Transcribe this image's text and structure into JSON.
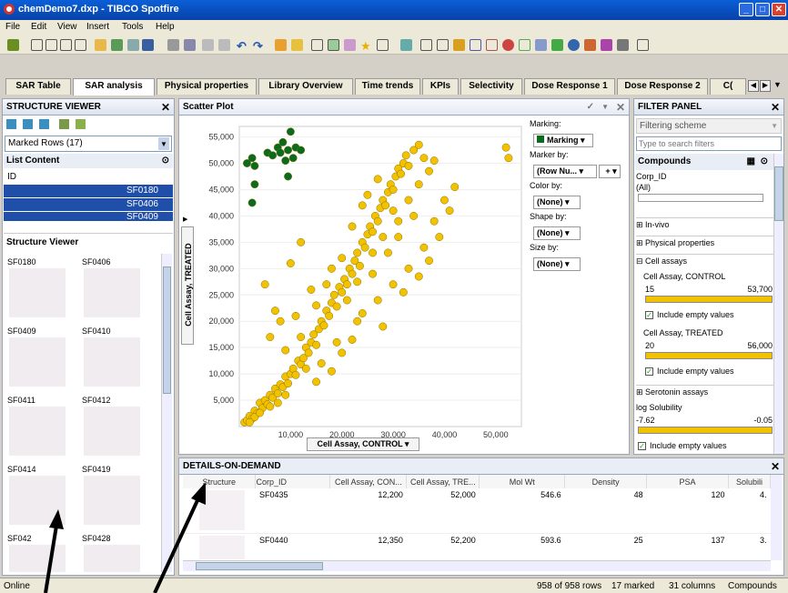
{
  "window": {
    "title": "chemDemo7.dxp - TIBCO Spotfire"
  },
  "menu": [
    "File",
    "Edit",
    "View",
    "Insert",
    "Tools",
    "Help"
  ],
  "tabs": [
    "SAR Table",
    "SAR analysis",
    "Physical properties",
    "Library Overview",
    "Time trends",
    "KPIs",
    "Selectivity",
    "Dose Response 1",
    "Dose Response 2",
    "C("
  ],
  "structure_viewer": {
    "title": "STRUCTURE VIEWER",
    "marking_select": "Marked Rows (17)",
    "list_content_label": "List Content",
    "list_header": "ID",
    "list_items": [
      "SF0180",
      "SF0406",
      "SF0409"
    ],
    "viewer_label": "Structure Viewer",
    "thumbs": [
      "SF0180",
      "SF0406",
      "SF0409",
      "SF0410",
      "SF0411",
      "SF0412",
      "SF0414",
      "SF0419",
      "SF042",
      "SF0428"
    ]
  },
  "scatter": {
    "title": "Scatter Plot",
    "marking_label": "Marking:",
    "marking_value": "Marking",
    "marker_by_label": "Marker by:",
    "marker_by_value": "(Row Nu...",
    "color_by_label": "Color by:",
    "color_by_value": "(None)",
    "shape_by_label": "Shape by:",
    "shape_by_value": "(None)",
    "size_by_label": "Size by:",
    "size_by_value": "(None)",
    "x_axis_selector": "Cell Assay, CONTROL",
    "y_axis_selector": "Cell Assay, TREATED"
  },
  "chart_data": {
    "type": "scatter",
    "xlabel": "Cell Assay, CONTROL",
    "ylabel": "Cell Assay, TREATED",
    "xlim": [
      0,
      55000
    ],
    "ylim": [
      0,
      57000
    ],
    "xticks": [
      "10,000",
      "20,000",
      "30,000",
      "40,000",
      "50,000"
    ],
    "yticks": [
      "5,000",
      "10,000",
      "15,000",
      "20,000",
      "25,000",
      "30,000",
      "35,000",
      "40,000",
      "45,000",
      "50,000",
      "55,000"
    ],
    "series": [
      {
        "color": "#f2c200",
        "points": [
          [
            1000,
            800
          ],
          [
            1500,
            1200
          ],
          [
            2000,
            2000
          ],
          [
            2500,
            1500
          ],
          [
            3000,
            3000
          ],
          [
            3500,
            2500
          ],
          [
            4000,
            4500
          ],
          [
            4500,
            3500
          ],
          [
            5000,
            5000
          ],
          [
            5500,
            4200
          ],
          [
            6000,
            6000
          ],
          [
            6500,
            5500
          ],
          [
            7000,
            7200
          ],
          [
            7500,
            6300
          ],
          [
            8000,
            8000
          ],
          [
            8500,
            7500
          ],
          [
            9000,
            9500
          ],
          [
            9500,
            8200
          ],
          [
            10000,
            10000
          ],
          [
            10500,
            11000
          ],
          [
            11000,
            9800
          ],
          [
            11500,
            12500
          ],
          [
            12000,
            11800
          ],
          [
            12500,
            13000
          ],
          [
            13000,
            15000
          ],
          [
            13500,
            14000
          ],
          [
            14000,
            16000
          ],
          [
            14500,
            17500
          ],
          [
            15000,
            15500
          ],
          [
            15500,
            18500
          ],
          [
            16000,
            20000
          ],
          [
            16500,
            19200
          ],
          [
            17000,
            22000
          ],
          [
            17500,
            21000
          ],
          [
            18000,
            23500
          ],
          [
            18500,
            25000
          ],
          [
            19000,
            22800
          ],
          [
            19500,
            26500
          ],
          [
            20000,
            25500
          ],
          [
            20500,
            28000
          ],
          [
            21000,
            27000
          ],
          [
            21500,
            30000
          ],
          [
            22000,
            29000
          ],
          [
            22500,
            31500
          ],
          [
            23000,
            33000
          ],
          [
            23500,
            30500
          ],
          [
            24000,
            35000
          ],
          [
            24500,
            34000
          ],
          [
            25000,
            36500
          ],
          [
            25500,
            38000
          ],
          [
            26000,
            37000
          ],
          [
            26500,
            40000
          ],
          [
            27000,
            39000
          ],
          [
            27500,
            41500
          ],
          [
            28000,
            43000
          ],
          [
            28500,
            42000
          ],
          [
            29000,
            44500
          ],
          [
            29500,
            46000
          ],
          [
            30000,
            45000
          ],
          [
            30500,
            47500
          ],
          [
            31000,
            49000
          ],
          [
            31500,
            48000
          ],
          [
            32000,
            50000
          ],
          [
            32500,
            51500
          ],
          [
            33000,
            49500
          ],
          [
            34000,
            52500
          ],
          [
            35000,
            53500
          ],
          [
            36000,
            51000
          ],
          [
            37000,
            48500
          ],
          [
            38000,
            50500
          ],
          [
            52000,
            53000
          ],
          [
            52500,
            51000
          ],
          [
            9000,
            14500
          ],
          [
            12000,
            17000
          ],
          [
            15000,
            23000
          ],
          [
            17000,
            27000
          ],
          [
            20000,
            32000
          ],
          [
            22000,
            38000
          ],
          [
            24000,
            42000
          ],
          [
            11000,
            21000
          ],
          [
            14000,
            26000
          ],
          [
            18000,
            30000
          ],
          [
            25000,
            44000
          ],
          [
            27000,
            47000
          ],
          [
            6000,
            17000
          ],
          [
            8000,
            20000
          ],
          [
            10000,
            31000
          ],
          [
            12000,
            35000
          ],
          [
            5000,
            27000
          ],
          [
            7000,
            22000
          ],
          [
            16000,
            12000
          ],
          [
            19000,
            16000
          ],
          [
            23000,
            20000
          ],
          [
            27000,
            24000
          ],
          [
            30000,
            27000
          ],
          [
            33000,
            30000
          ],
          [
            36000,
            34000
          ],
          [
            38000,
            39000
          ],
          [
            40000,
            43000
          ],
          [
            34000,
            40000
          ],
          [
            31000,
            36000
          ],
          [
            29000,
            33000
          ],
          [
            26000,
            29000
          ],
          [
            21000,
            24000
          ],
          [
            13000,
            11000
          ],
          [
            9000,
            6000
          ],
          [
            3000,
            1800
          ],
          [
            4000,
            2600
          ],
          [
            2000,
            800
          ],
          [
            6000,
            3800
          ],
          [
            7500,
            4500
          ],
          [
            22000,
            16500
          ],
          [
            18000,
            10500
          ],
          [
            15000,
            8500
          ],
          [
            20000,
            14000
          ],
          [
            28000,
            19000
          ],
          [
            24000,
            21500
          ],
          [
            32000,
            25500
          ],
          [
            35000,
            28500
          ],
          [
            37000,
            31500
          ],
          [
            39000,
            36000
          ],
          [
            41000,
            41000
          ],
          [
            42000,
            45500
          ],
          [
            31000,
            39000
          ],
          [
            33000,
            43000
          ],
          [
            35000,
            46000
          ],
          [
            30000,
            41000
          ],
          [
            28000,
            36000
          ],
          [
            26000,
            33000
          ],
          [
            23000,
            27500
          ]
        ]
      },
      {
        "color": "#0a6b1f",
        "points": [
          [
            1500,
            50000
          ],
          [
            2500,
            51000
          ],
          [
            3000,
            49500
          ],
          [
            5500,
            52000
          ],
          [
            6500,
            51500
          ],
          [
            7500,
            53000
          ],
          [
            8000,
            52000
          ],
          [
            8500,
            54000
          ],
          [
            9000,
            50500
          ],
          [
            9500,
            52500
          ],
          [
            10500,
            51000
          ],
          [
            10000,
            56000
          ],
          [
            11000,
            53000
          ],
          [
            12000,
            52500
          ],
          [
            3000,
            46000
          ],
          [
            9500,
            47500
          ],
          [
            2500,
            42500
          ]
        ]
      }
    ]
  },
  "details": {
    "title": "DETAILS-ON-DEMAND",
    "columns": [
      "Structure",
      "Corp_ID",
      "Cell Assay, CON...",
      "Cell Assay, TRE...",
      "Mol Wt",
      "Density",
      "PSA",
      "Solubili"
    ],
    "rows": [
      [
        "",
        "SF0435",
        "12,200",
        "52,000",
        "546.6",
        "48",
        "120",
        "4."
      ],
      [
        "",
        "SF0440",
        "12,350",
        "52,200",
        "593.6",
        "25",
        "137",
        "3."
      ]
    ]
  },
  "filter_panel": {
    "title": "FILTER PANEL",
    "scheme": "Filtering scheme",
    "search_placeholder": "Type to search filters",
    "compounds_label": "Compounds",
    "corp_id_label": "Corp_ID",
    "corp_id_value": "(All)",
    "groups": [
      "In-vivo",
      "Physical properties",
      "Cell assays"
    ],
    "control": {
      "label": "Cell Assay, CONTROL",
      "min": "15",
      "max": "53,700"
    },
    "treated": {
      "label": "Cell Assay, TREATED",
      "min": "20",
      "max": "56,000"
    },
    "include_empty": "Include empty values",
    "serotonin": "Serotonin assays",
    "solubility": {
      "label": "log Solubility",
      "min": "-7.62",
      "max": "-0.05"
    }
  },
  "status": {
    "state": "Online",
    "rows": "958 of 958 rows",
    "marked": "17 marked",
    "columns": "31 columns",
    "table": "Compounds"
  }
}
